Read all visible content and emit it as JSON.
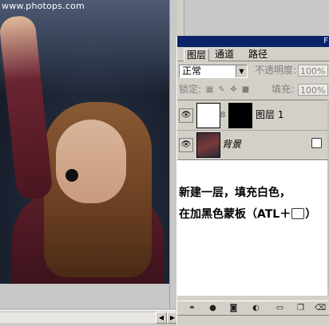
{
  "document": {
    "watermark": "www.photops.com",
    "scroll_left": "◀",
    "scroll_right": "▶"
  },
  "palette": {
    "title_mark": "F",
    "tabs": [
      {
        "label": "图层",
        "active": true
      },
      {
        "label": "通道",
        "active": false
      },
      {
        "label": "路径",
        "active": false
      }
    ],
    "blend_mode": "正常",
    "opacity_label": "不透明度:",
    "opacity_value": "100%",
    "lock_label": "锁定:",
    "fill_label": "填充:",
    "fill_value": "100%",
    "layers": [
      {
        "name": "图层 1",
        "visible": true,
        "has_mask": true
      },
      {
        "name": "背景",
        "visible": true,
        "locked": true
      }
    ],
    "eye_glyph": "👁",
    "chain_glyph": "8",
    "lock_glyph": "🔒"
  },
  "annotation": {
    "line1": "新建一层，填充白色，",
    "line2_prefix": "在加黑色蒙板（ATL＋",
    "line2_suffix": "）"
  },
  "colors": {
    "titlebar": "#0a246a",
    "panel_bg": "#d4d0c8"
  },
  "icons": {
    "bottom_bar": [
      "link-icon",
      "fx-icon",
      "mask-icon",
      "adjustment-icon",
      "folder-icon",
      "new-layer-icon",
      "trash-icon"
    ]
  }
}
